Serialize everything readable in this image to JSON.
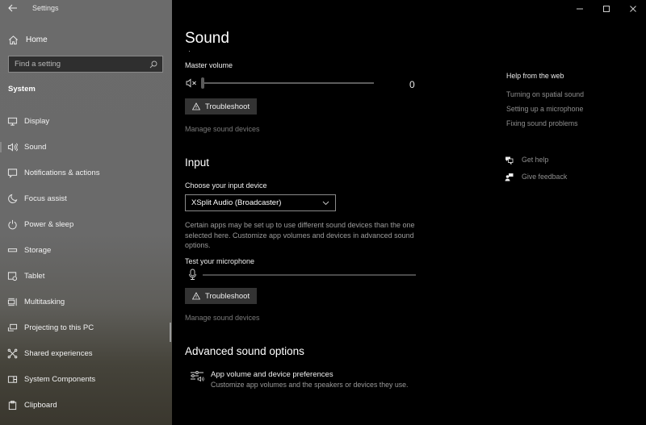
{
  "window": {
    "title": "Settings",
    "controls": {
      "minimize": "minimize",
      "maximize": "maximize",
      "close": "close"
    }
  },
  "sidebar": {
    "home_label": "Home",
    "search_placeholder": "Find a setting",
    "section_label": "System",
    "active_item": "Sound",
    "items": [
      {
        "label": "Display",
        "icon": "display-icon"
      },
      {
        "label": "Sound",
        "icon": "speaker-icon"
      },
      {
        "label": "Notifications & actions",
        "icon": "notification-icon"
      },
      {
        "label": "Focus assist",
        "icon": "moon-icon"
      },
      {
        "label": "Power & sleep",
        "icon": "power-icon"
      },
      {
        "label": "Storage",
        "icon": "storage-icon"
      },
      {
        "label": "Tablet",
        "icon": "tablet-icon"
      },
      {
        "label": "Multitasking",
        "icon": "multitasking-icon"
      },
      {
        "label": "Projecting to this PC",
        "icon": "projecting-icon"
      },
      {
        "label": "Shared experiences",
        "icon": "shared-experiences-icon"
      },
      {
        "label": "System Components",
        "icon": "system-components-icon"
      },
      {
        "label": "Clipboard",
        "icon": "clipboard-icon"
      }
    ]
  },
  "main": {
    "title": "Sound",
    "output": {
      "master_volume_label": "Master volume",
      "volume_value": "0",
      "volume_percent": 0,
      "muted": true,
      "troubleshoot_label": "Troubleshoot",
      "manage_devices_label": "Manage sound devices"
    },
    "input": {
      "heading": "Input",
      "choose_device_label": "Choose your input device",
      "selected_device": "XSplit Audio (Broadcaster)",
      "description": "Certain apps may be set up to use different sound devices than the one selected here. Customize app volumes and devices in advanced sound options.",
      "test_mic_label": "Test your microphone",
      "mic_level_percent": 0,
      "troubleshoot_label": "Troubleshoot",
      "manage_devices_label": "Manage sound devices"
    },
    "advanced": {
      "heading": "Advanced sound options",
      "item_title": "App volume and device preferences",
      "item_desc": "Customize app volumes and the speakers or devices they use."
    }
  },
  "help": {
    "title": "Help from the web",
    "links": [
      "Turning on spatial sound",
      "Setting up a microphone",
      "Fixing sound problems"
    ],
    "get_help": "Get help",
    "give_feedback": "Give feedback"
  }
}
